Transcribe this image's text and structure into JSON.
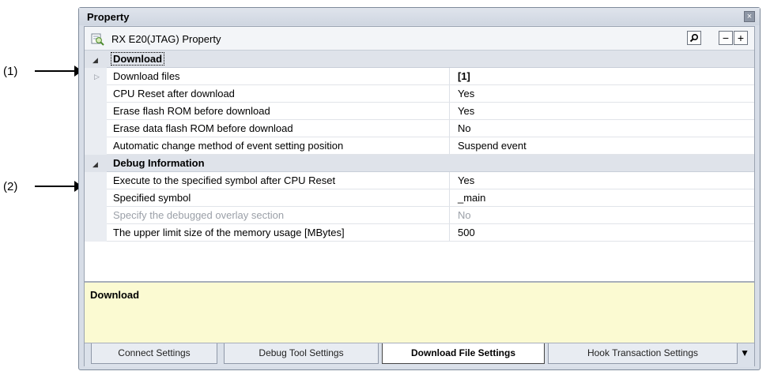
{
  "callouts": [
    {
      "label": "(1)"
    },
    {
      "label": "(2)"
    }
  ],
  "panel": {
    "title": "Property",
    "close_glyph": "×"
  },
  "toolbar": {
    "title": "RX E20(JTAG) Property",
    "icon": "property-page-icon",
    "search_glyph": "⚲",
    "collapse_glyph": "−",
    "expand_glyph": "+"
  },
  "grid": {
    "categories": [
      {
        "name": "Download",
        "expander": "◢",
        "rows": [
          {
            "name": "Download files",
            "value": "[1]",
            "expandable": true,
            "bold_value": true
          },
          {
            "name": "CPU Reset after download",
            "value": "Yes"
          },
          {
            "name": "Erase flash ROM before download",
            "value": "Yes"
          },
          {
            "name": "Erase data flash ROM before download",
            "value": "No"
          },
          {
            "name": "Automatic change method of event setting position",
            "value": "Suspend event"
          }
        ]
      },
      {
        "name": "Debug Information",
        "expander": "◢",
        "rows": [
          {
            "name": "Execute to the specified symbol after CPU Reset",
            "value": "Yes"
          },
          {
            "name": "Specified symbol",
            "value": "_main"
          },
          {
            "name": "Specify the debugged overlay section",
            "value": "No",
            "disabled": true
          },
          {
            "name": "The upper limit size of the memory usage [MBytes]",
            "value": "500"
          }
        ]
      }
    ],
    "row_expand_glyph": "▷"
  },
  "description": {
    "title": "Download"
  },
  "tabs": [
    {
      "label": "Connect Settings",
      "active": false
    },
    {
      "label": "Debug Tool Settings",
      "active": false
    },
    {
      "label": "Download File Settings",
      "active": true
    },
    {
      "label": "Hook Transaction Settings",
      "active": false
    }
  ],
  "tab_menu_glyph": "▼"
}
